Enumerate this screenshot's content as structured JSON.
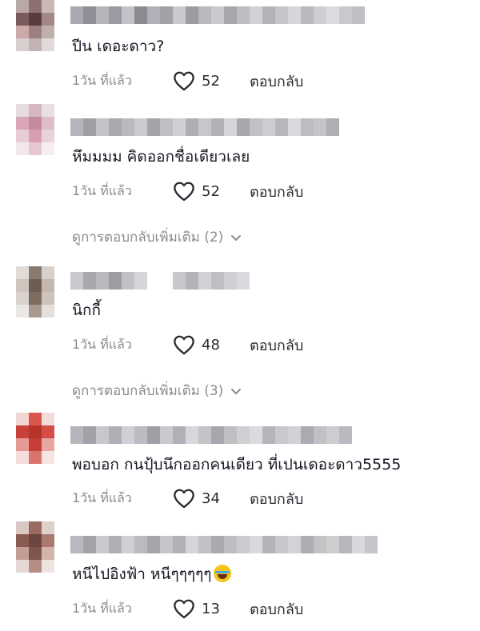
{
  "comments": [
    {
      "text": "ปีน เดอะดาว?",
      "time": "1วัน ที่แล้ว",
      "likes": "52",
      "reply": "ตอบกลับ",
      "avatar_colors": [
        "#b9a8a8",
        "#8e7070",
        "#c9b8b8",
        "#7a5a5a",
        "#5b3c3c",
        "#a48888",
        "#caa",
        "#9d7f7f",
        "#bfb0b0",
        "#d8d0d0",
        "#c2b2b2",
        "#e0dada"
      ],
      "name_colors": [
        "#a9a9b0",
        "#8f8f97",
        "#b5b5bb",
        "#9a9aa2",
        "#c2c2c7",
        "#8a8a92",
        "#b0b0b6",
        "#a1a1a8",
        "#cacace",
        "#9c9ca3",
        "#b8b8be",
        "#c9c9ce",
        "#a6a6ad",
        "#bdbdc2",
        "#d3d3d7",
        "#b2b2b8",
        "#c5c5ca",
        "#d6d6da",
        "#b9b9bf",
        "#cfcfd3",
        "#dcdce0",
        "#c8c8cd",
        "#bfbfc4"
      ]
    },
    {
      "text": "หึมมมม คิดออกชื่อเดียวเลย",
      "time": "1วัน ที่แล้ว",
      "likes": "52",
      "reply": "ตอบกลับ",
      "more": "ดูการตอบกลับเพิ่มเติม (2)",
      "avatar_colors": [
        "#e6dbe0",
        "#d4b7c2",
        "#eadfe4",
        "#d9a6b6",
        "#c58a9c",
        "#e0bcc8",
        "#e8cdd5",
        "#d6a0b0",
        "#e9d2da",
        "#f2e8ec",
        "#e3c8d1",
        "#f6eef1"
      ],
      "name_colors": [
        "#b4b4ba",
        "#9e9ea5",
        "#c3c3c8",
        "#a8a8af",
        "#b9b9bf",
        "#cbcbcf",
        "#a3a3aa",
        "#bebec3",
        "#d0d0d4",
        "#adadb3",
        "#c6c6cb",
        "#b1b1b7",
        "#d5d5d9",
        "#a7a7ae",
        "#c0c0c5",
        "#cdcdd1",
        "#b6b6bc",
        "#d9d9dd",
        "#bcbcc1",
        "#c4c4c9",
        "#aeaeb4"
      ]
    },
    {
      "text": "นิกกี้",
      "time": "1วัน ที่แล้ว",
      "likes": "48",
      "reply": "ตอบกลับ",
      "more": "ดูการตอบกลับเพิ่มเติม (3)",
      "avatar_colors": [
        "#e2dcd8",
        "#8a7b70",
        "#d8d0ca",
        "#cfc5be",
        "#6e5e52",
        "#c4b8ae",
        "#d9d2cd",
        "#7d6c60",
        "#cdc3bb",
        "#ebe7e4",
        "#a89a90",
        "#e4dfdb"
      ],
      "name_colors": [
        "#c9c9ce",
        "#a7a7ae",
        "#b8b8be",
        "#9c9ca3",
        "#c1c1c6",
        "#d6d6da",
        "#ffffff",
        "#ffffff",
        "#c6c6cb",
        "#b2b2b8",
        "#d2d2d6",
        "#bebec3",
        "#cfcfd3",
        "#dadade",
        "#ffffff",
        "#ffffff"
      ]
    },
    {
      "text": "พอบอก กนปุ้บนึกออกคนเดียว ที่เปนเดอะดาว5555",
      "time": "1วัน ที่แล้ว",
      "likes": "34",
      "reply": "ตอบกลับ",
      "avatar_colors": [
        "#f0d6d3",
        "#d8564e",
        "#f2dcd9",
        "#c7413a",
        "#b7342d",
        "#d44d46",
        "#e79a94",
        "#c53e37",
        "#e8a6a1",
        "#f3dedb",
        "#d9736c",
        "#f5e4e2"
      ],
      "name_colors": [
        "#b5b5bb",
        "#a1a1a8",
        "#c7c7cc",
        "#afafb5",
        "#d1d1d5",
        "#bbbbc1",
        "#9f9fa6",
        "#c9c9ce",
        "#b0b0b6",
        "#d7d7db",
        "#c3c3c8",
        "#a6a6ad",
        "#bebec3",
        "#cfcfd3",
        "#dbdbdf",
        "#b4b4ba",
        "#c8c8cd",
        "#d2d2d6",
        "#aaaab1",
        "#c0c0c5",
        "#cdcdd1",
        "#b9b9bf"
      ]
    },
    {
      "text": "หนีไปอิงฟ้า หนีๆๆๆๆๆ",
      "time": "1วัน ที่แล้ว",
      "likes": "13",
      "reply": "ตอบกลับ",
      "emoji": "face-with-tears-of-joy-icon",
      "avatar_colors": [
        "#d9c7c3",
        "#9a6a60",
        "#e0cfcb",
        "#8a5b52",
        "#6e463f",
        "#a87a70",
        "#c49e96",
        "#7f564e",
        "#d3b4ad",
        "#e6d8d5",
        "#b58d85",
        "#eee3e1"
      ],
      "name_colors": [
        "#b8b8be",
        "#a2a2a9",
        "#c9c9ce",
        "#aeaeb4",
        "#d0d0d4",
        "#babac0",
        "#a5a5ac",
        "#c4c4c9",
        "#b1b1b7",
        "#d5d5d9",
        "#c1c1c6",
        "#a9a9b0",
        "#bdbdc2",
        "#cbcbcf",
        "#d9d9dd",
        "#b3b3b9",
        "#c7c7cc",
        "#d3d3d7",
        "#adadb3",
        "#c2c2c7",
        "#cececf",
        "#b6b6bc",
        "#d8d8dc",
        "#c5c5ca"
      ]
    }
  ],
  "icons": {
    "like": "heart-outline-icon",
    "expand": "chevron-down-icon"
  },
  "colors": {
    "text": "#161823",
    "muted": "#8a8b91",
    "action": "#2b2c33"
  }
}
